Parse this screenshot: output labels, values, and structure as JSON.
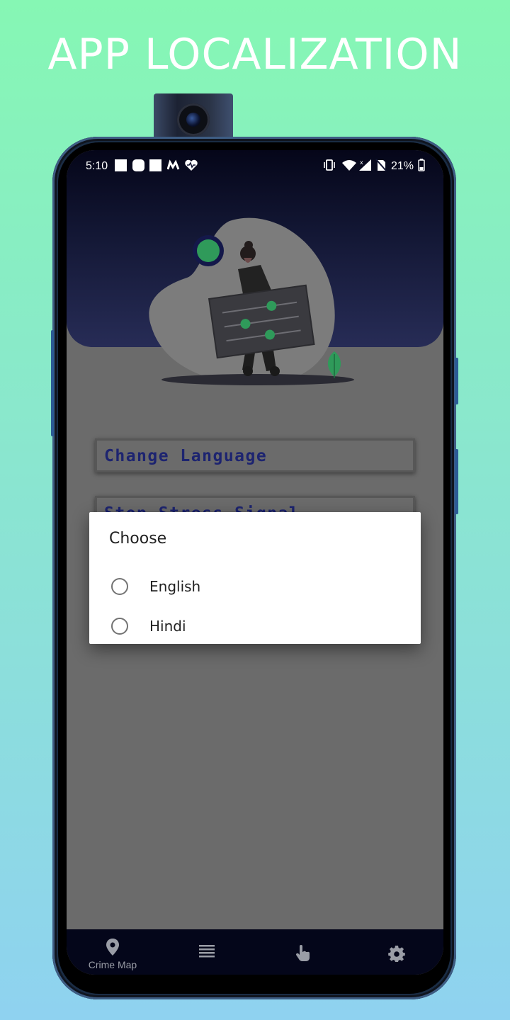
{
  "banner": {
    "title": "APP LOCALIZATION"
  },
  "status_bar": {
    "time": "5:10",
    "battery": "21%",
    "icons": [
      "square-icon",
      "rounded-square-icon",
      "square-icon",
      "m-logo-icon",
      "heart-pulse-icon",
      "vibrate-icon",
      "wifi-icon",
      "signal-icon",
      "no-sim-icon",
      "battery-icon"
    ]
  },
  "main": {
    "change_language_label": "Change Language",
    "stress_signal_label": "Stop Stress Signal"
  },
  "dialog": {
    "title": "Choose",
    "options": [
      {
        "label": "English",
        "selected": false
      },
      {
        "label": "Hindi",
        "selected": false
      }
    ]
  },
  "bottom_nav": {
    "items": [
      {
        "icon": "location-pin-icon",
        "label": "Crime Map"
      },
      {
        "icon": "list-icon",
        "label": ""
      },
      {
        "icon": "touch-icon",
        "label": ""
      },
      {
        "icon": "gear-icon",
        "label": ""
      }
    ]
  },
  "colors": {
    "accent": "#1d2470",
    "overlay": "#6b6b6b",
    "header": "#272c56"
  }
}
